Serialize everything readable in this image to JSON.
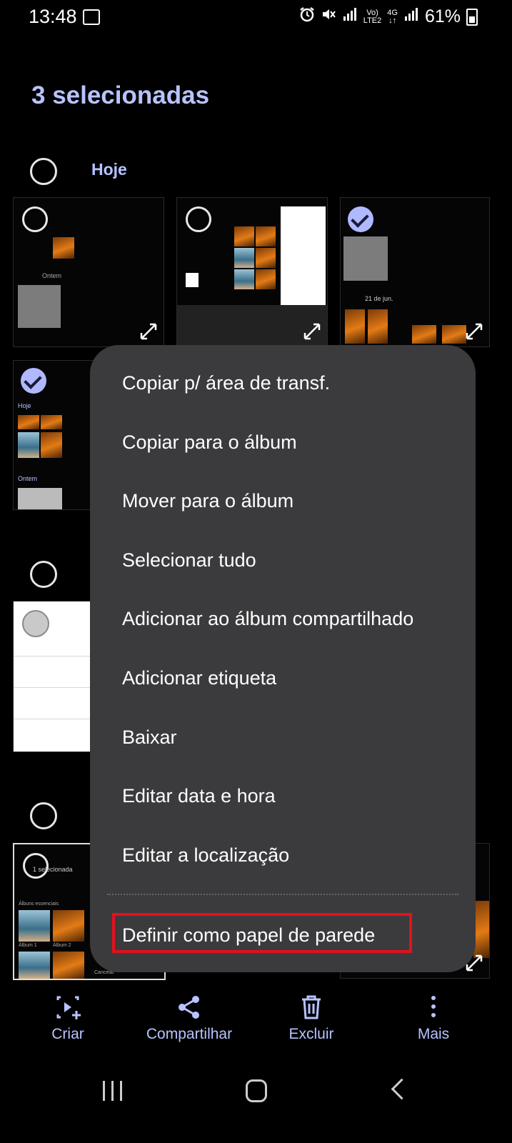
{
  "status_bar": {
    "time": "13:48",
    "network_vo": "Vo)",
    "network_lte": "LTE2",
    "network_4g": "4G",
    "battery": "61%",
    "icons": [
      "gallery-icon",
      "alarm-icon",
      "mute-icon",
      "signal-icon",
      "volte-icon",
      "4g-icon",
      "signal-icon",
      "battery-icon"
    ]
  },
  "header": {
    "title": "3 selecionadas"
  },
  "sections": [
    {
      "label": "Hoje"
    }
  ],
  "thumb_texts": {
    "ontem": "Ontem",
    "hoje": "Hoje",
    "date_21": "21 de jun.",
    "um_selecionada": "1 selecionada",
    "album_essenciais": "Álbuns essenciais",
    "album_1": "Álbum 1",
    "album_2": "Álbum 2",
    "cancelar": "Cancelar"
  },
  "menu": {
    "items": [
      "Copiar p/ área de transf.",
      "Copiar para o álbum",
      "Mover para o álbum",
      "Selecionar tudo",
      "Adicionar ao álbum compartilhado",
      "Adicionar etiqueta",
      "Baixar",
      "Editar data e hora",
      "Editar a localização"
    ],
    "highlighted_item": "Definir como papel de parede",
    "highlight_color": "#e4101c",
    "background": "#3b3b3d"
  },
  "bottom_actions": [
    {
      "label": "Criar",
      "icon": "create-icon"
    },
    {
      "label": "Compartilhar",
      "icon": "share-icon"
    },
    {
      "label": "Excluir",
      "icon": "trash-icon"
    },
    {
      "label": "Mais",
      "icon": "more-vertical-icon"
    }
  ],
  "colors": {
    "accent": "#b8c3ff",
    "background": "#000000"
  }
}
